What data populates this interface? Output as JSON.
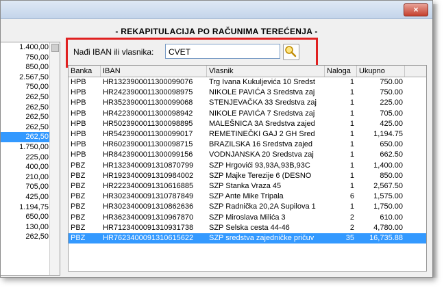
{
  "window": {
    "close_label": "×"
  },
  "heading": "- REKAPITULACIJA PO RAČUNIMA TEREĆENJA -",
  "left_values": [
    "1.400,00",
    "750,00",
    "850,00",
    "2.567,50",
    "750,00",
    "262,50",
    "262,50",
    "262,50",
    "262,50",
    "262,50",
    "1.750,00",
    "225,00",
    "400,00",
    "210,00",
    "705,00",
    "425,00",
    "1.194,75",
    "650,00",
    "130,00",
    "262,50"
  ],
  "left_selected_index": 9,
  "search": {
    "label": "Nađi IBAN ili vlasnika:",
    "value": "CVET"
  },
  "grid": {
    "columns": {
      "banka": "Banka",
      "iban": "IBAN",
      "vlasnik": "Vlasnik",
      "naloga": "Naloga",
      "ukupno": "Ukupno"
    },
    "rows": [
      {
        "banka": "HPB",
        "iban": "HR1323900011300099076",
        "vlasnik": "Trg Ivana Kukuljevića 10  Sredst",
        "naloga": "1",
        "ukupno": "750.00"
      },
      {
        "banka": "HPB",
        "iban": "HR2423900011300098975",
        "vlasnik": "NIKOLE PAVIĆA 3  Sredstva zaj",
        "naloga": "1",
        "ukupno": "750.00"
      },
      {
        "banka": "HPB",
        "iban": "HR3523900011300099068",
        "vlasnik": "STENJEVAČKA 33  Sredstva zaj",
        "naloga": "1",
        "ukupno": "225.00"
      },
      {
        "banka": "HPB",
        "iban": "HR4223900011300098942",
        "vlasnik": "NIKOLE PAVIĆA 7  Sredstva zaj",
        "naloga": "1",
        "ukupno": "705.00"
      },
      {
        "banka": "HPB",
        "iban": "HR5023900011300098895",
        "vlasnik": "MALEŠNICA 3A  Sredstva zajed",
        "naloga": "1",
        "ukupno": "425.00"
      },
      {
        "banka": "HPB",
        "iban": "HR5423900011300099017",
        "vlasnik": "REMETINEČKI GAJ 2 GH  Sred",
        "naloga": "1",
        "ukupno": "1,194.75"
      },
      {
        "banka": "HPB",
        "iban": "HR6023900011300098715",
        "vlasnik": "BRAZILSKA 16  Sredstva zajed",
        "naloga": "1",
        "ukupno": "650.00"
      },
      {
        "banka": "HPB",
        "iban": "HR8423900011300099156",
        "vlasnik": "VODNJANSKA 20  Sredstva zaj",
        "naloga": "1",
        "ukupno": "662.50"
      },
      {
        "banka": "PBZ",
        "iban": "HR1323400091310870799",
        "vlasnik": "SZP Hrgovići 93,93A,93B,93C",
        "naloga": "1",
        "ukupno": "1,400.00"
      },
      {
        "banka": "PBZ",
        "iban": "HR1923400091310984002",
        "vlasnik": "SZP Majke Terezije 6 (DESNO",
        "naloga": "1",
        "ukupno": "850.00"
      },
      {
        "banka": "PBZ",
        "iban": "HR2223400091310616885",
        "vlasnik": "SZP Stanka Vraza 45",
        "naloga": "1",
        "ukupno": "2,567.50"
      },
      {
        "banka": "PBZ",
        "iban": "HR3023400091310787849",
        "vlasnik": "SZP Ante Mike Tripala",
        "naloga": "6",
        "ukupno": "1,575.00"
      },
      {
        "banka": "PBZ",
        "iban": "HR3023400091310862636",
        "vlasnik": "SZP Radnička 20,2A Supilova 1",
        "naloga": "1",
        "ukupno": "1,750.00"
      },
      {
        "banka": "PBZ",
        "iban": "HR3623400091310967870",
        "vlasnik": "SZP Miroslava Milića 3",
        "naloga": "2",
        "ukupno": "610.00"
      },
      {
        "banka": "PBZ",
        "iban": "HR7123400091310931738",
        "vlasnik": "SZP Selska cesta 44-46",
        "naloga": "2",
        "ukupno": "4,780.00"
      },
      {
        "banka": "PBZ",
        "iban": "HR7623400091310615622",
        "vlasnik": "SZP sredstva zajedničke pričuv",
        "naloga": "35",
        "ukupno": "16,735.88"
      }
    ],
    "selected_index": 15
  }
}
